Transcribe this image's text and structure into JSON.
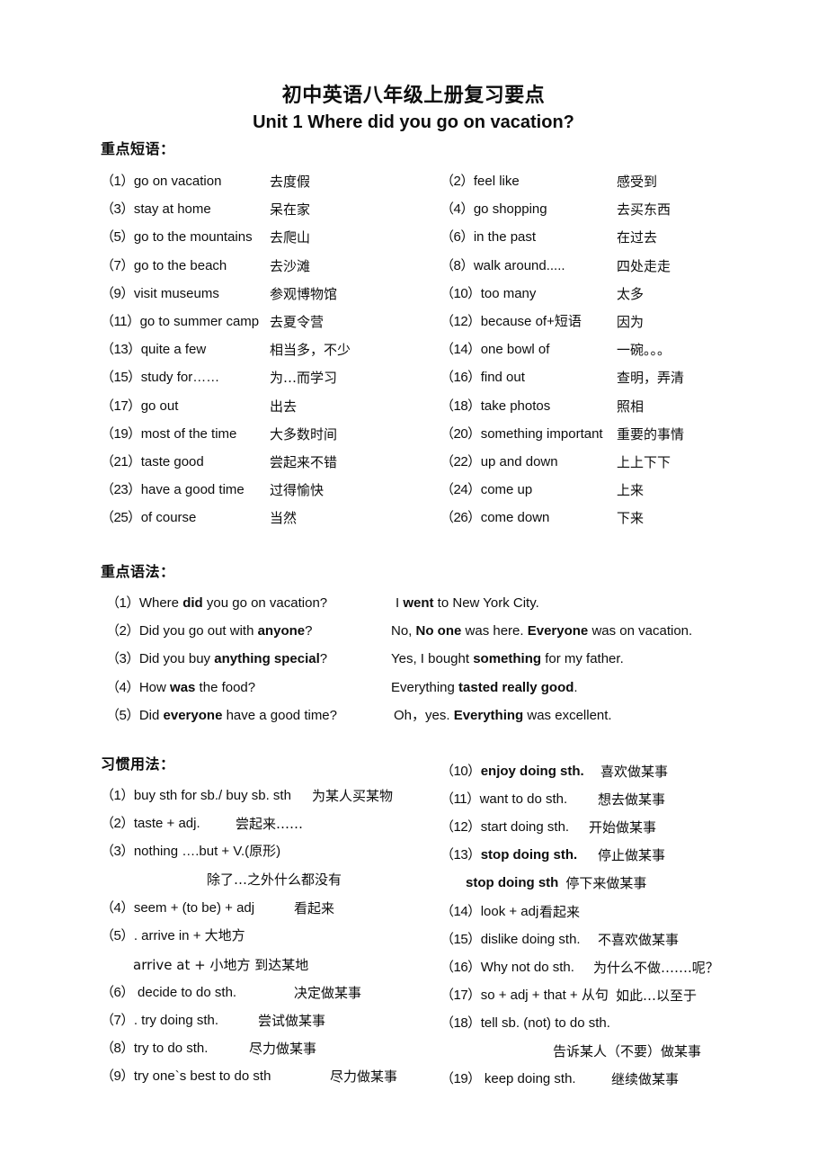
{
  "document": {
    "title": "初中英语八年级上册复习要点",
    "subtitle": "Unit 1 Where did you go on vacation?"
  },
  "sections": {
    "phrases": {
      "label": "重点短语：",
      "left": [
        {
          "num": "（1）",
          "en": "go on vacation",
          "zh": "去度假"
        },
        {
          "num": "（3）",
          "en": "stay at home",
          "zh": "呆在家"
        },
        {
          "num": "（5）",
          "en": "go to the mountains",
          "zh": "去爬山"
        },
        {
          "num": "（7）",
          "en": "go to the beach",
          "zh": "去沙滩"
        },
        {
          "num": "（9）",
          "en": "visit museums",
          "zh": "参观博物馆"
        },
        {
          "num": "（11）",
          "en": "go to summer camp",
          "zh": "去夏令营"
        },
        {
          "num": "（13）",
          "en": "quite a few",
          "zh": "相当多，不少"
        },
        {
          "num": "（15）",
          "en": "study for……",
          "zh": "为…而学习"
        },
        {
          "num": "（17）",
          "en": "go out",
          "zh": "出去"
        },
        {
          "num": "（19）",
          "en": "most of the time",
          "zh": "大多数时间"
        },
        {
          "num": "（21）",
          "en": "taste good",
          "zh": "尝起来不错"
        },
        {
          "num": "（23）",
          "en": "have a good time",
          "zh": "过得愉快"
        },
        {
          "num": "（25）",
          "en": "of course",
          "zh": "当然"
        }
      ],
      "right": [
        {
          "num": "（2）",
          "en": "feel like",
          "zh": "感受到"
        },
        {
          "num": "（4）",
          "en": "go shopping",
          "zh": "去买东西"
        },
        {
          "num": "（6）",
          "en": "in the past",
          "zh": "在过去"
        },
        {
          "num": "（8）",
          "en": "walk around.....",
          "zh": "四处走走"
        },
        {
          "num": "（10）",
          "en": "too many",
          "zh": "太多"
        },
        {
          "num": "（12）",
          "en": "because of+短语",
          "zh": "因为"
        },
        {
          "num": "（14）",
          "en": "one bowl of",
          "zh": "一碗。。。"
        },
        {
          "num": "（16）",
          "en": "find out",
          "zh": "查明，弄清"
        },
        {
          "num": "（18）",
          "en": "take photos",
          "zh": "照相"
        },
        {
          "num": "（20）",
          "en": "something important",
          "zh": "重要的事情"
        },
        {
          "num": "（22）",
          "en": "up and down",
          "zh": "上上下下"
        },
        {
          "num": "（24）",
          "en": "come up",
          "zh": "上来"
        },
        {
          "num": "（26）",
          "en": "come down",
          "zh": "下来"
        }
      ]
    },
    "grammar": {
      "label": "重点语法：",
      "items": [
        {
          "num": "（1）",
          "q_pre": "Where ",
          "q_bold": "did",
          "q_post": " you go on vacation?",
          "a_pre": "I ",
          "a_bold": "went",
          "a_post": " to New York City."
        },
        {
          "num": "（2）",
          "q_pre": "Did you go out with ",
          "q_bold": "anyone",
          "q_post": "?",
          "a_pre": "No, ",
          "a_bold": "No one",
          "a_mid": " was here. ",
          "a_bold2": "Everyone",
          "a_post": " was on vacation."
        },
        {
          "num": "（3）",
          "q_pre": "Did you buy ",
          "q_bold": "anything special",
          "q_post": "?",
          "a_pre": "Yes, I bought ",
          "a_bold": "something",
          "a_post": " for my father."
        },
        {
          "num": "（4）",
          "q_pre": "How ",
          "q_bold": "was",
          "q_post": " the food?",
          "a_pre": "Everything ",
          "a_bold": "tasted really good",
          "a_post": "."
        },
        {
          "num": "（5）",
          "q_pre": "Did ",
          "q_bold": "everyone",
          "q_post": " have a good time?",
          "a_pre": "Oh，yes. ",
          "a_bold": "Everything",
          "a_post": " was excellent."
        }
      ]
    },
    "usage": {
      "label": "习惯用法：",
      "left": [
        {
          "num": "（1）",
          "en": "buy sth for sb./ buy sb. sth",
          "zh": "为某人买某物",
          "bold": false
        },
        {
          "num": "（2）",
          "en": "taste + adj.",
          "zh": "尝起来……",
          "bold": false
        },
        {
          "num": "（3）",
          "en": "nothing ….but + V.(原形)",
          "zh": "",
          "bold": false
        },
        {
          "num": "（4）",
          "en": "seem + (to be) + adj",
          "zh": "看起来",
          "bold": false
        },
        {
          "num": "（5）",
          "en": ". arrive in +  大地方",
          "zh": "",
          "bold": false
        },
        {
          "num": "（6）",
          "en": "  decide to do sth.",
          "zh": "决定做某事",
          "bold": false
        },
        {
          "num": "（7）",
          "en": ". try doing sth.",
          "zh": "尝试做某事",
          "bold": false
        },
        {
          "num": "（8）",
          "en": "try to do sth.",
          "zh": "尽力做某事",
          "bold": false
        },
        {
          "num": "（9）",
          "en": "try one`s best to do sth",
          "zh": "尽力做某事",
          "bold": false
        }
      ],
      "left_sub": [
        {
          "text": "除了…之外什么都没有"
        },
        {
          "text": "arrive at +  小地方  到达某地"
        }
      ],
      "right": [
        {
          "num": "（10）",
          "en": "enjoy doing sth.",
          "zh": "喜欢做某事",
          "bold": true
        },
        {
          "num": "（11）",
          "en": "want to do sth.",
          "zh": "想去做某事",
          "bold": false
        },
        {
          "num": "（12）",
          "en": "start doing sth.",
          "zh": "开始做某事",
          "bold": false
        },
        {
          "num": "（13）",
          "en": "stop doing sth.",
          "zh": "停止做某事",
          "bold": true
        },
        {
          "num": "（14）",
          "en": "look + adj",
          "zh": "看起来",
          "bold": false
        },
        {
          "num": "（15）",
          "en": "dislike doing sth.",
          "zh": "不喜欢做某事",
          "bold": false
        },
        {
          "num": "（16）",
          "en": "Why not do sth.",
          "zh": "为什么不做…….呢？",
          "bold": false
        },
        {
          "num": "（17）",
          "en": "so + adj + that +  从句",
          "zh": "如此…以至于",
          "bold": false
        },
        {
          "num": "（18）",
          "en": "tell sb. (not) to do sth.",
          "zh": "",
          "bold": false
        },
        {
          "num": "（19）",
          "en": "  keep doing sth.",
          "zh": "继续做某事",
          "bold": false
        }
      ],
      "right_sub": [
        {
          "en": "stop doing sth",
          "zh": "停下来做某事"
        },
        {
          "zh": "告诉某人（不要）做某事"
        }
      ]
    }
  }
}
